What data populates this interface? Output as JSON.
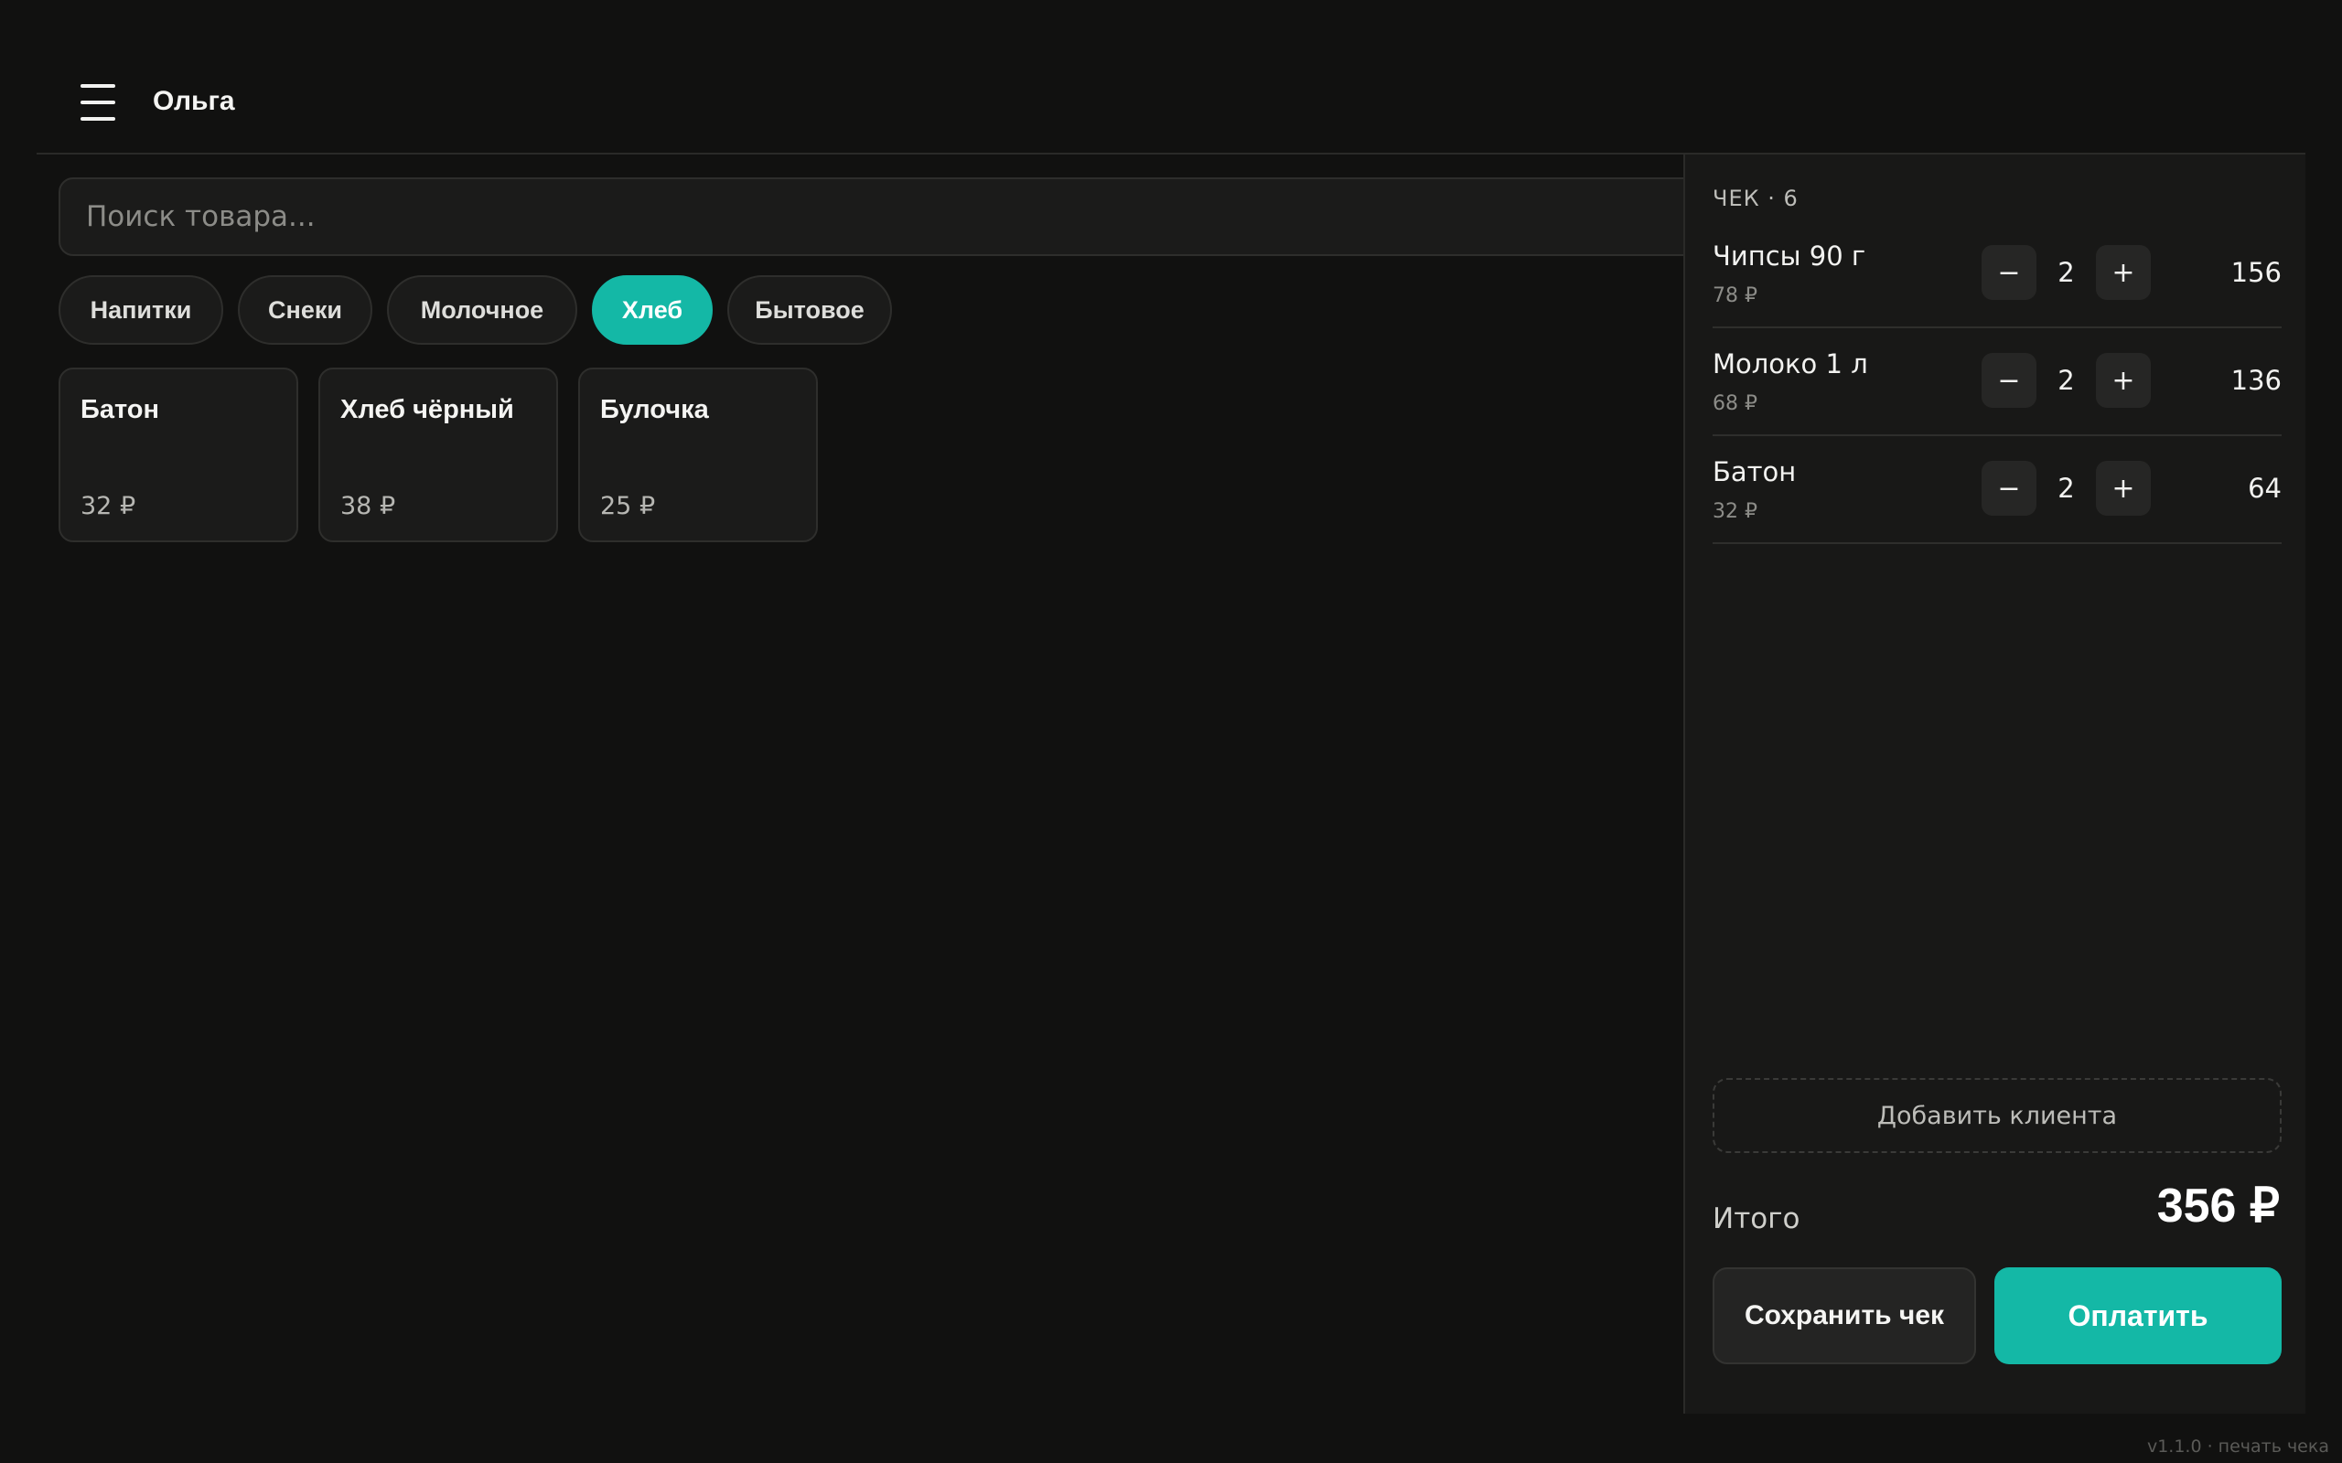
{
  "header": {
    "menu_icon": "hamburger-menu-icon",
    "user_name": "Ольга"
  },
  "search": {
    "placeholder": "Поиск товара...",
    "value": ""
  },
  "categories": [
    {
      "label": "Напитки",
      "active": false
    },
    {
      "label": "Снеки",
      "active": false
    },
    {
      "label": "Молочное",
      "active": false
    },
    {
      "label": "Хлеб",
      "active": true
    },
    {
      "label": "Бытовое",
      "active": false
    }
  ],
  "products": [
    {
      "name": "Батон",
      "price": "32 ₽"
    },
    {
      "name": "Хлеб чёрный",
      "price": "38 ₽"
    },
    {
      "name": "Булочка",
      "price": "25 ₽"
    }
  ],
  "receipt": {
    "title": "ЧЕК · 6",
    "lines": [
      {
        "name": "Чипсы 90 г",
        "unit_price": "78 ₽",
        "qty": "2",
        "total": "156"
      },
      {
        "name": "Молоко 1 л",
        "unit_price": "68 ₽",
        "qty": "2",
        "total": "136"
      },
      {
        "name": "Батон",
        "unit_price": "32 ₽",
        "qty": "2",
        "total": "64"
      }
    ],
    "minus_label": "−",
    "plus_label": "+",
    "add_client_label": "Добавить клиента",
    "total_label": "Итого",
    "total_value": "356 ₽",
    "save_label": "Сохранить чек",
    "pay_label": "Оплатить"
  },
  "footer": {
    "version": "v1.1.0 · печать чека"
  },
  "colors": {
    "accent": "#14b8a6",
    "background": "#111110",
    "panel": "#181817"
  }
}
